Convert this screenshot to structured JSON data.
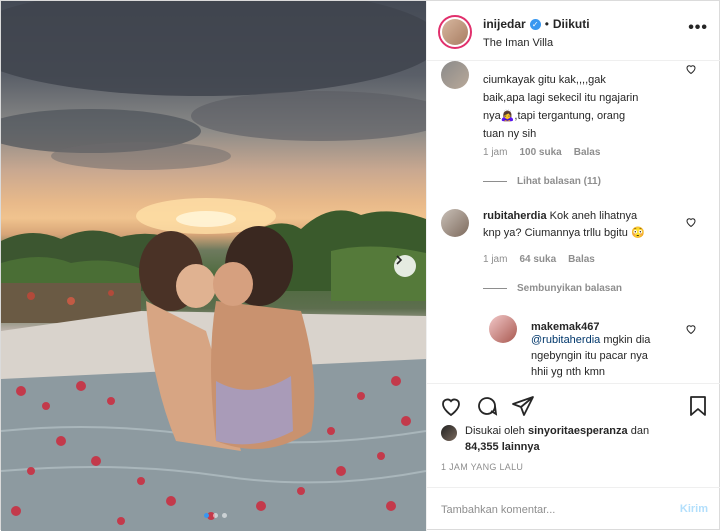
{
  "post": {
    "image_alt": "photo",
    "carousel": {
      "count": 3,
      "active": 1
    }
  },
  "header": {
    "username": "inijedar",
    "separator": "•",
    "follow_status": "Diikuti",
    "location": "The Iman Villa",
    "more": "•••"
  },
  "comments": [
    {
      "username": "",
      "text": "ciumkayak gitu kak,,,,gak baik,apa lagi sekecil itu ngajarin nya🙇‍♀️,tapi tergantung, orang tuan ny sih",
      "line0": "ciumkayak gitu kak,,,,gak",
      "line1": "baik,apa lagi sekecil itu ngajarin",
      "line2": "nya🙇‍♀️,tapi tergantung, orang",
      "line3": "tuan ny sih",
      "time": "1 jam",
      "likes": "100 suka",
      "reply": "Balas",
      "replies_toggle": "Lihat balasan (11)"
    },
    {
      "username": "rubitaherdia",
      "text": "Kok aneh lihatnya knp ya? Ciumannya trllu bgitu 😳",
      "line0": "Kok aneh lihatnya",
      "line1": "knp ya? Ciumannya trllu bgitu 😳",
      "time": "1 jam",
      "likes": "64 suka",
      "reply": "Balas",
      "replies_toggle": "Sembunyikan balasan"
    },
    {
      "username": "makemak467",
      "mention": "@rubitaherdia",
      "line0": " mgkin dia",
      "line1": "ngebyngin itu pacar nya",
      "line2": "hhii yg nth kmn"
    }
  ],
  "actions": {
    "like_icon": "heart-icon",
    "comment_icon": "comment-icon",
    "share_icon": "share-icon",
    "save_icon": "bookmark-icon"
  },
  "likes": {
    "prefix": "Disukai oleh",
    "user": "sinyoritaesperanza",
    "and": "dan",
    "count": "84,355",
    "suffix": "lainnya"
  },
  "timestamp": "1 JAM YANG LALU",
  "comment_box": {
    "placeholder": "Tambahkan komentar...",
    "send_label": "Kirim"
  },
  "colors": {
    "accent": "#3897f0",
    "send_disabled": "#b2dffc",
    "muted": "#8e8e8e",
    "text": "#262626"
  }
}
